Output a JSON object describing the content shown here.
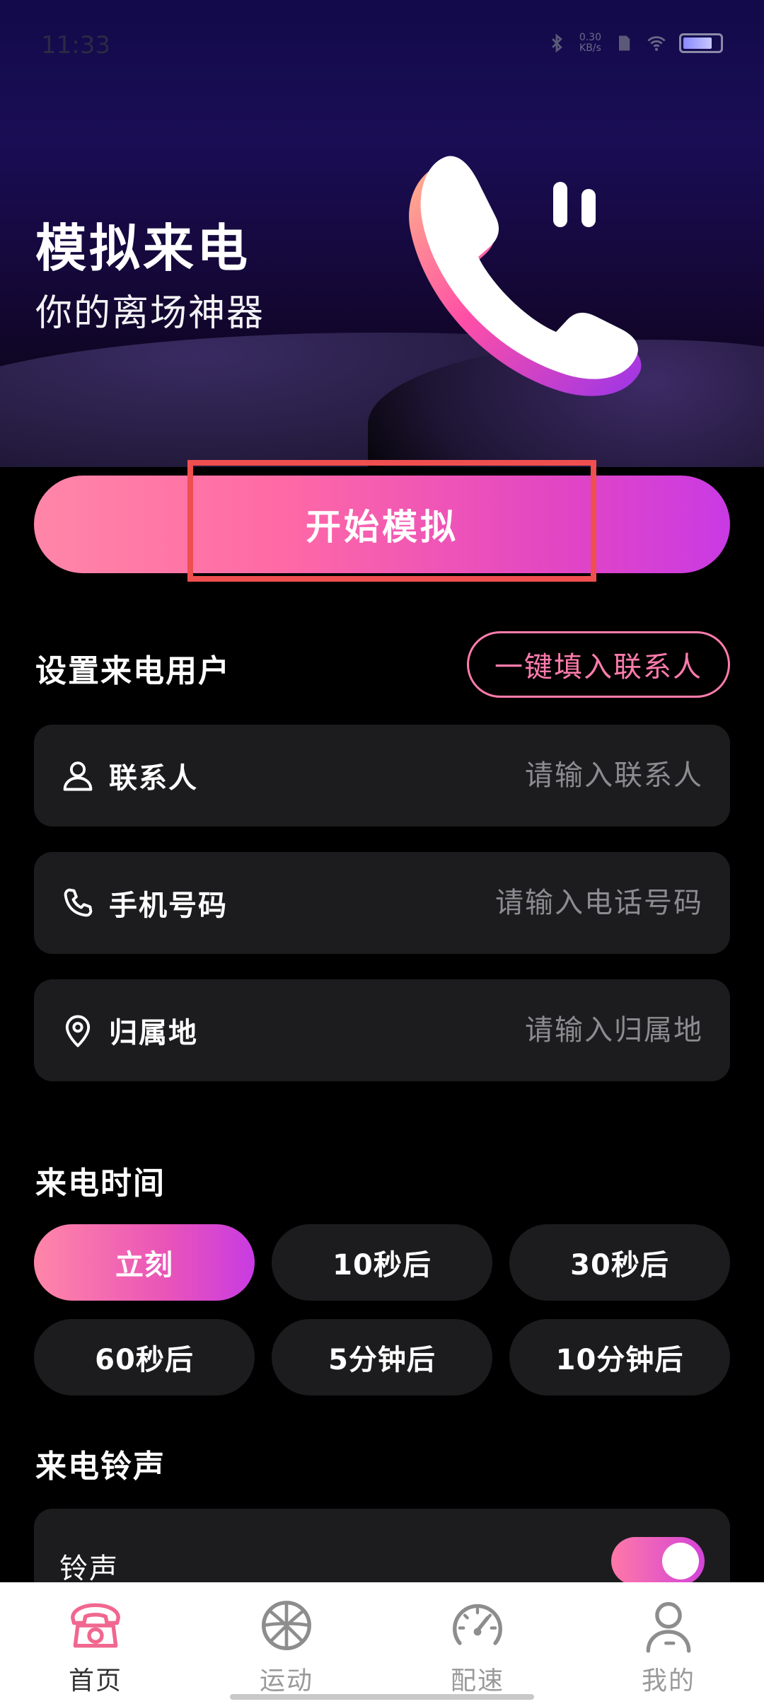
{
  "status_bar": {
    "time": "11:33",
    "net_speed_value": "0.30",
    "net_speed_unit": "KB/s",
    "battery_level": 0.8
  },
  "hero": {
    "title": "模拟来电",
    "subtitle": "你的离场神器"
  },
  "start_button": {
    "label": "开始模拟"
  },
  "caller_section": {
    "title": "设置来电用户",
    "fill_contacts_label": "一键填入联系人",
    "fields": [
      {
        "label": "联系人",
        "placeholder": "请输入联系人",
        "value": ""
      },
      {
        "label": "手机号码",
        "placeholder": "请输入电话号码",
        "value": ""
      },
      {
        "label": "归属地",
        "placeholder": "请输入归属地",
        "value": ""
      }
    ]
  },
  "time_section": {
    "title": "来电时间",
    "options": [
      "立刻",
      "10秒后",
      "30秒后",
      "60秒后",
      "5分钟后",
      "10分钟后"
    ],
    "selected": "立刻"
  },
  "ringtone_section": {
    "title": "来电铃声",
    "ringtone_label": "铃声",
    "ringtone_enabled": true
  },
  "bottom_nav": {
    "items": [
      {
        "label": "首页",
        "icon": "telephone-icon",
        "active": true
      },
      {
        "label": "运动",
        "icon": "basketball-icon",
        "active": false
      },
      {
        "label": "配速",
        "icon": "speedometer-icon",
        "active": false
      },
      {
        "label": "我的",
        "icon": "user-icon",
        "active": false
      }
    ]
  },
  "colors": {
    "accent_pink": "#ff7cac",
    "accent_purple": "#c93ae4",
    "card_bg": "#1c1c1e",
    "highlight_box": "#ef4f4f"
  }
}
